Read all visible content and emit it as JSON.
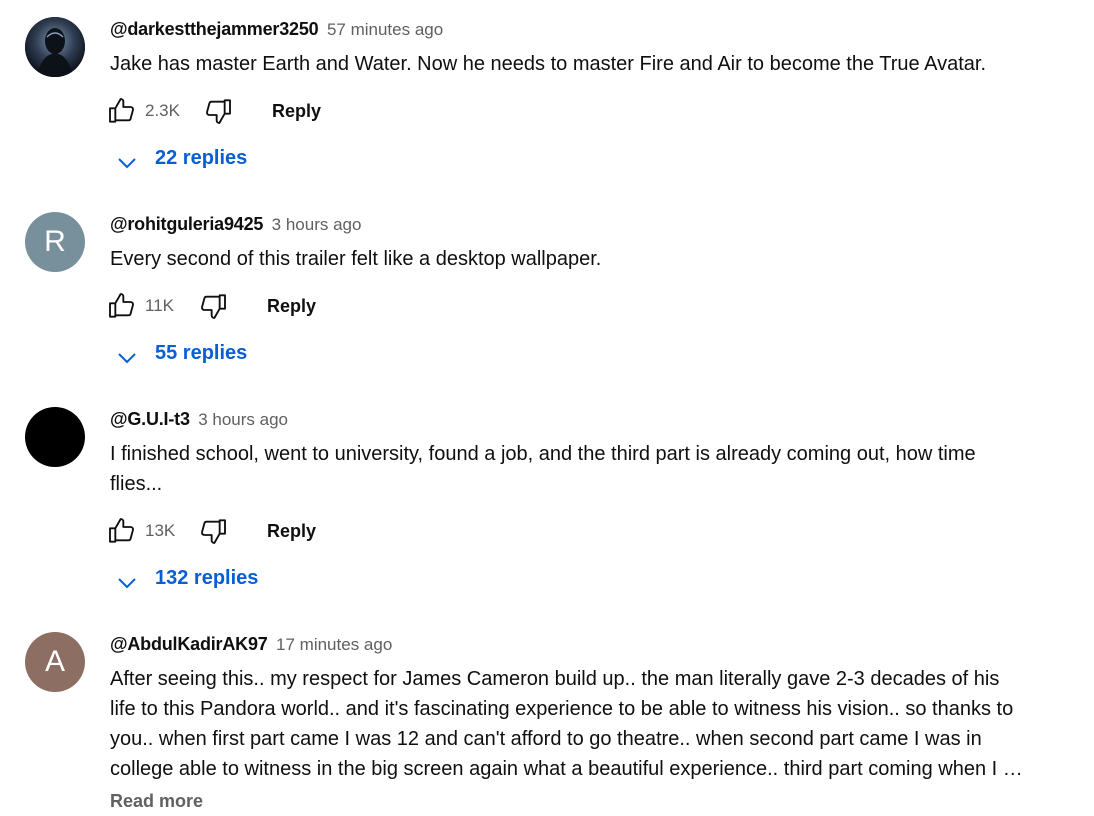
{
  "comments": [
    {
      "author": "@darkestthejammer3250",
      "time": "57 minutes ago",
      "text": "Jake has master Earth and Water. Now he needs to master Fire and Air to become the True Avatar.",
      "likes": "2.3K",
      "reply_label": "Reply",
      "replies_label": "22 replies",
      "avatar_type": "image"
    },
    {
      "author": "@rohitguleria9425",
      "time": "3 hours ago",
      "text": "Every second of this trailer felt like a desktop wallpaper.",
      "likes": "11K",
      "reply_label": "Reply",
      "replies_label": "55 replies",
      "avatar_letter": "R",
      "avatar_color": "#78909c"
    },
    {
      "author": "@G.U.I-t3",
      "time": "3 hours ago",
      "text_line1": "I finished school, went to university, found a job, and the third part is already coming out, how time",
      "text_line2": "flies...",
      "likes": "13K",
      "reply_label": "Reply",
      "replies_label": "132 replies",
      "avatar_color": "#000000"
    },
    {
      "author": "@AbdulKadirAK97",
      "time": "17 minutes ago",
      "text_line1": "After seeing this.. my respect for James Cameron build up.. the man literally gave 2-3 decades of his",
      "text_line2": "life to this Pandora world.. and it's fascinating experience to be able to witness his vision.. so thanks to",
      "text_line3": "you.. when first part came I was 12 and can't afford to go theatre.. when second part came I was in",
      "text_line4": "college able to witness in the big screen again what a beautiful experience.. third part coming when I",
      "ellipsis": "…",
      "read_more": "Read more",
      "avatar_letter": "A",
      "avatar_color": "#8d6e63"
    }
  ],
  "colors": {
    "link_blue": "#065fd4",
    "meta_gray": "#606060",
    "text": "#0f0f0f"
  },
  "icons": {
    "like": "thumb-up-icon",
    "dislike": "thumb-down-icon",
    "expand": "chevron-down-icon"
  }
}
